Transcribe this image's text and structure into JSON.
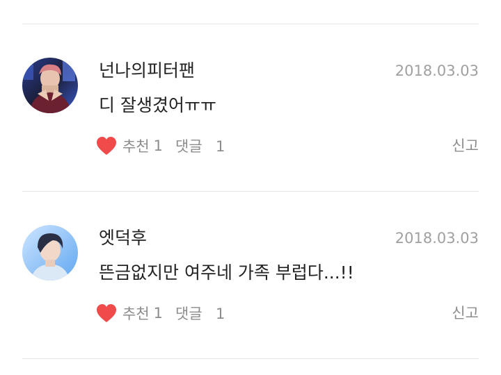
{
  "comments": [
    {
      "nickname": "넌나의피터팬",
      "date": "2018.03.03",
      "text": "디 잘생겼어ㅠㅠ",
      "like_label": "추천",
      "like_count": "1",
      "reply_label": "댓글",
      "reply_count": "1",
      "report_label": "신고",
      "avatar_icon": "user-avatar-1"
    },
    {
      "nickname": "엣덕후",
      "date": "2018.03.03",
      "text": "뜬금없지만 여주네 가족 부럽다...!!",
      "like_label": "추천",
      "like_count": "1",
      "reply_label": "댓글",
      "reply_count": "1",
      "report_label": "신고",
      "avatar_icon": "user-avatar-2"
    }
  ],
  "colors": {
    "heart": "#f04a4a",
    "text": "#222222",
    "meta": "#8c8c8c",
    "date": "#a0a0a0",
    "divider": "#e6e6e6"
  }
}
